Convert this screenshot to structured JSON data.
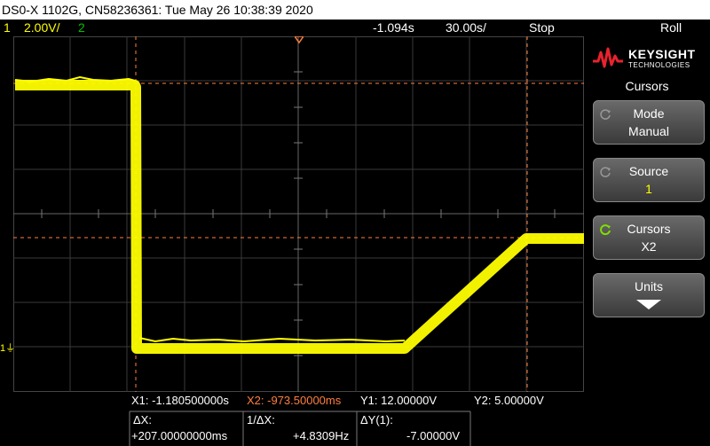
{
  "title_bar": {
    "text": "DS0-X 1102G, CN58236361: Tue May 26 10:38:39 2020"
  },
  "status": {
    "ch1_label": "1",
    "ch1_scale": "2.00V/",
    "ch2_label": "2",
    "time_offset": "-1.094s",
    "time_scale": "30.00s/",
    "run_state": "Stop",
    "mode": "Roll"
  },
  "colors": {
    "ch1": "#ffff00",
    "ch2": "#00c000",
    "cursor": "#ff7f3f",
    "grid": "#555555"
  },
  "right_panel": {
    "brand": "KEYSIGHT",
    "brand_sub": "TECHNOLOGIES",
    "menu_title": "Cursors",
    "softkeys": [
      {
        "line1": "Mode",
        "line2": "Manual",
        "icon": "rotate-icon"
      },
      {
        "line1": "Source",
        "line2": "1",
        "icon": "rotate-icon"
      },
      {
        "line1": "Cursors",
        "line2": "X2",
        "icon": "rotate-active-icon"
      },
      {
        "line1": "Units",
        "line2": "",
        "icon": "chevron-down-icon"
      }
    ]
  },
  "readouts": {
    "x1": "X1: -1.180500000s",
    "x2": "X2: -973.50000ms",
    "y1": "Y1:  12.00000V",
    "y2": "Y2:  5.00000V",
    "dx_label": "ΔX:",
    "dx_value": "+207.00000000ms",
    "inv_dx_label": "1/ΔX:",
    "inv_dx_value": "+4.8309Hz",
    "dy_label": "ΔY(1):",
    "dy_value": "-7.00000V"
  },
  "ground_marker": "1"
}
